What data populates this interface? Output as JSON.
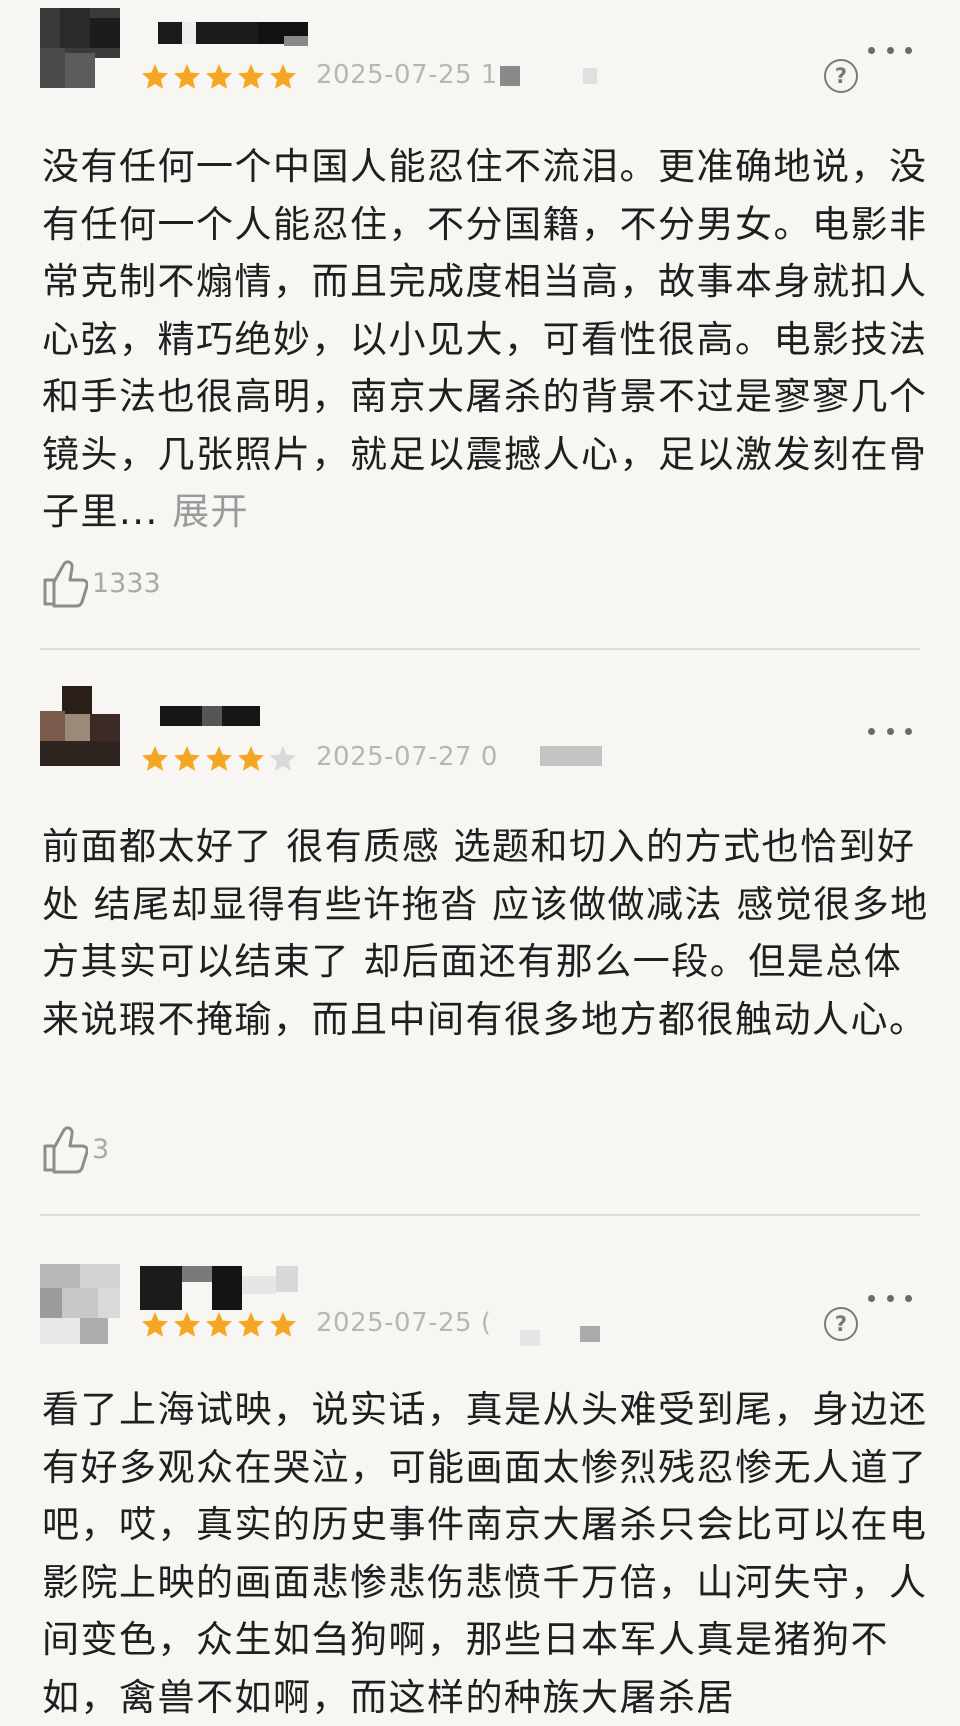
{
  "reviews": [
    {
      "date": "2025-07-25 1",
      "rating": 5,
      "content": "没有任何一个中国人能忍住不流泪。更准确地说，没有任何一个人能忍住，不分国籍，不分男女。电影非常克制不煽情，而且完成度相当高，故事本身就扣人心弦，精巧绝妙，以小见大，可看性很高。电影技法和手法也很高明，南京大屠杀的背景不过是寥寥几个镜头，几张照片，就足以震撼人心，足以激发刻在骨子里...",
      "expand_label": "展开",
      "likes": "1333"
    },
    {
      "date": "2025-07-27 0",
      "rating": 4,
      "content": "前面都太好了 很有质感 选题和切入的方式也恰到好处 结尾却显得有些许拖沓 应该做做减法 感觉很多地方其实可以结束了 却后面还有那么一段。但是总体来说瑕不掩瑜，而且中间有很多地方都很触动人心。",
      "likes": "3"
    },
    {
      "date": "2025-07-25 (",
      "rating": 5,
      "content": "看了上海试映，说实话，真是从头难受到尾，身边还有好多观众在哭泣，可能画面太惨烈残忍惨无人道了吧，哎，真实的历史事件南京大屠杀只会比可以在电影院上映的画面悲惨悲伤悲愤千万倍，山河失守，人间变色，众生如刍狗啊，那些日本军人真是猪狗不如，禽兽不如啊，而这样的种族大屠杀居"
    }
  ],
  "colors": {
    "star_filled": "#f5a623",
    "star_empty": "#d9d9d9",
    "background": "#f7f6f2"
  },
  "icons": {
    "more": "more-dots-icon",
    "help": "help-circle-icon",
    "like": "thumbs-up-icon"
  },
  "help_glyph": "?"
}
